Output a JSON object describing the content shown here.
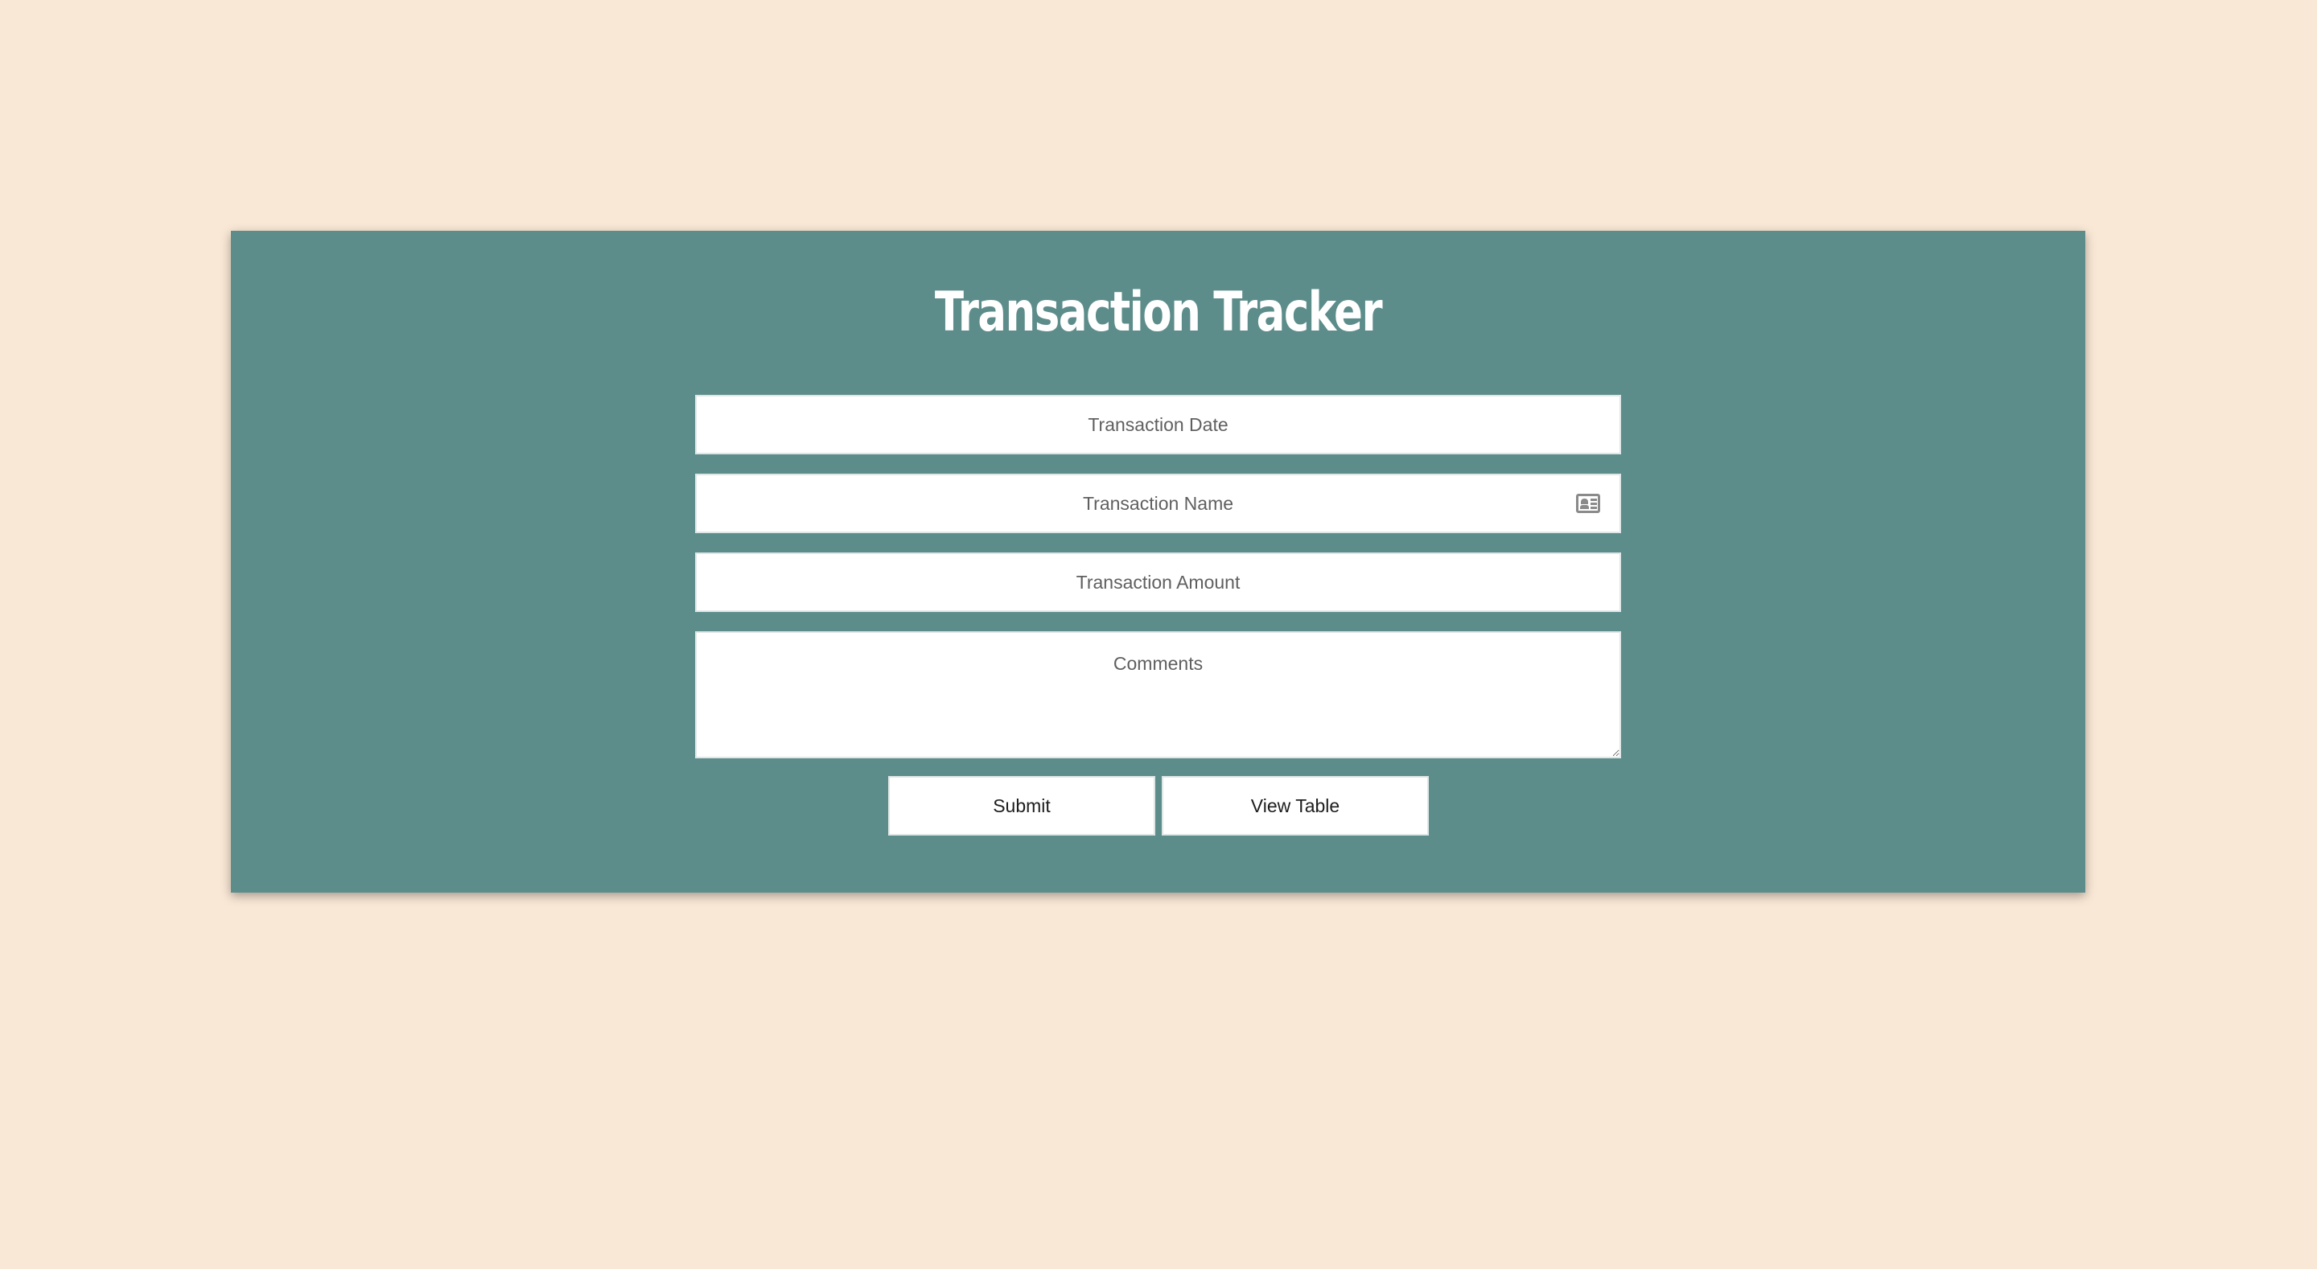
{
  "page": {
    "background_color": "#fae8d6",
    "card_color": "#5d8d8b"
  },
  "form": {
    "title": "Transaction Tracker",
    "fields": {
      "date": {
        "placeholder": "Transaction Date",
        "value": ""
      },
      "name": {
        "placeholder": "Transaction Name",
        "value": "",
        "icon": "contact-card-icon"
      },
      "amount": {
        "placeholder": "Transaction Amount",
        "value": ""
      },
      "comments": {
        "placeholder": "Comments",
        "value": ""
      }
    },
    "buttons": {
      "submit_label": "Submit",
      "view_table_label": "View Table"
    }
  }
}
